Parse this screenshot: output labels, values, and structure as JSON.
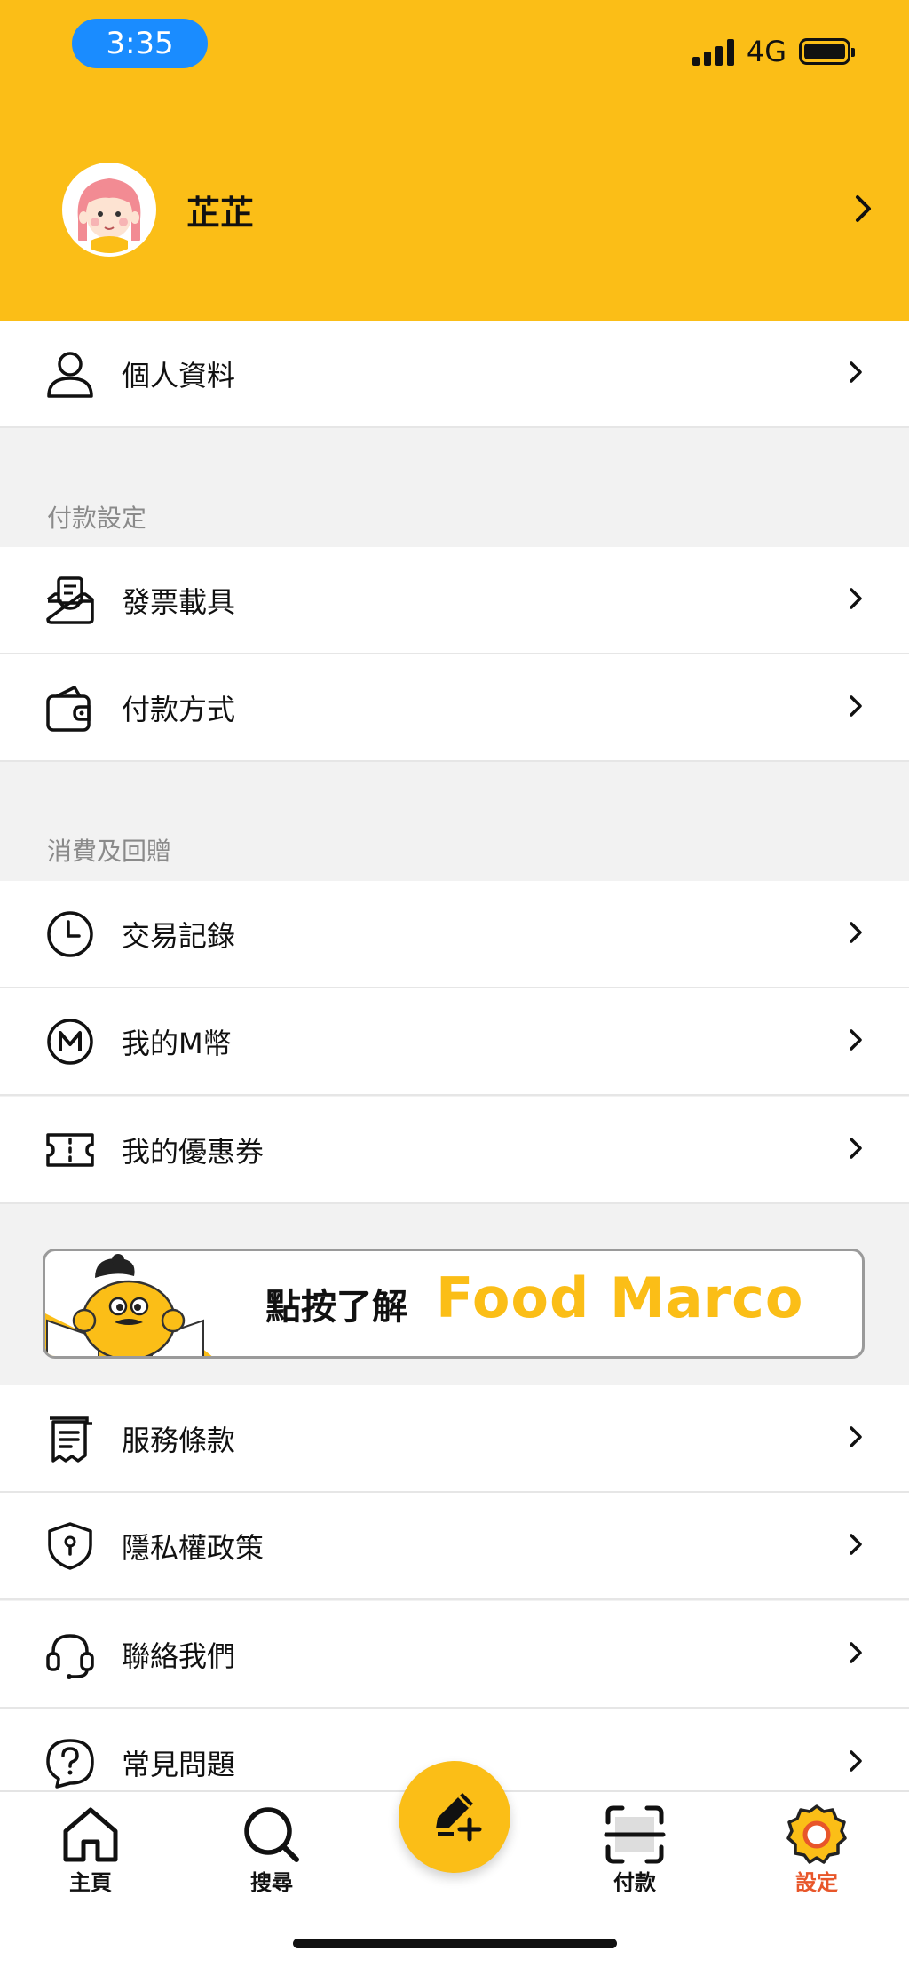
{
  "status_bar": {
    "time": "3:35",
    "network": "4G"
  },
  "profile": {
    "name": "芷芷"
  },
  "rows_top": [
    {
      "label": "個人資料",
      "icon": "person-icon"
    }
  ],
  "payment_section": {
    "title": "付款設定",
    "items": [
      {
        "label": "發票載具",
        "icon": "invoice-tray-icon"
      },
      {
        "label": "付款方式",
        "icon": "wallet-icon"
      }
    ]
  },
  "rewards_section": {
    "title": "消費及回贈",
    "items": [
      {
        "label": "交易記錄",
        "icon": "clock-icon"
      },
      {
        "label": "我的M幣",
        "icon": "m-coin-icon"
      },
      {
        "label": "我的優惠券",
        "icon": "coupon-icon"
      }
    ]
  },
  "banner": {
    "text": "點按了解",
    "brand": "Food Marco"
  },
  "info_section": {
    "items": [
      {
        "label": "服務條款",
        "icon": "terms-receipt-icon"
      },
      {
        "label": "隱私權政策",
        "icon": "shield-lock-icon"
      },
      {
        "label": "聯絡我們",
        "icon": "headset-icon"
      },
      {
        "label": "常見問題",
        "icon": "question-icon"
      }
    ]
  },
  "tabbar": {
    "home": "主頁",
    "search": "搜尋",
    "pay": "付款",
    "settings": "設定",
    "active": "settings"
  },
  "colors": {
    "brand": "#FBBE17",
    "active_tab": "#E8562A",
    "status_pill": "#1a8cff"
  }
}
